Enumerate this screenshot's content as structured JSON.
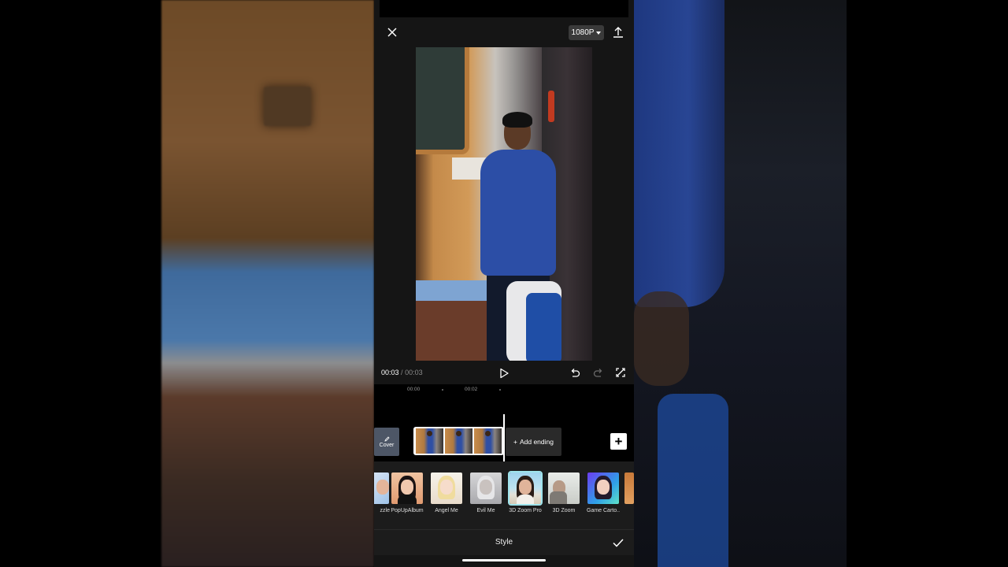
{
  "topbar": {
    "resolution": "1080P"
  },
  "playback": {
    "current_time": "00:03",
    "separator": "/",
    "total_time": "00:03"
  },
  "timeline": {
    "ticks": [
      "00:00",
      "00:02"
    ],
    "cover_label": "Cover",
    "add_ending_label": "Add ending"
  },
  "styles": {
    "items": [
      {
        "label": "zzle"
      },
      {
        "label": "PopUpAlbum"
      },
      {
        "label": "Angel Me"
      },
      {
        "label": "Evil Me"
      },
      {
        "label": "3D Zoom Pro"
      },
      {
        "label": "3D Zoom"
      },
      {
        "label": "Game Carto.."
      }
    ],
    "selected": "3D Zoom Pro"
  },
  "footer": {
    "title": "Style"
  },
  "colors": {
    "accent": "#9fe4ec",
    "background": "#151515",
    "timeline_bg": "#000000"
  }
}
